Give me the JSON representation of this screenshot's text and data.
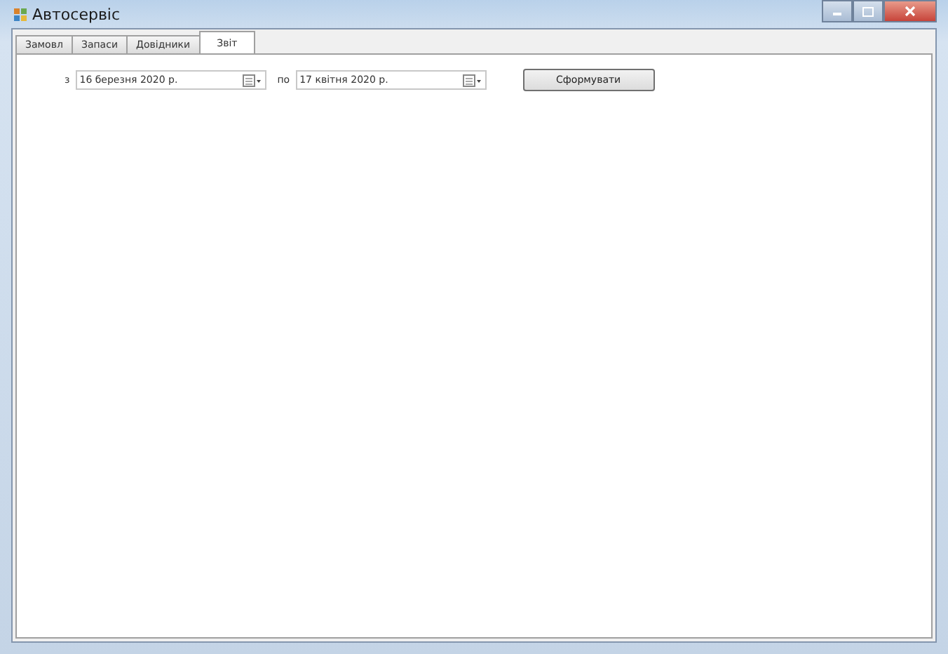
{
  "window": {
    "title": "Автосервіс"
  },
  "tabs": [
    {
      "label": "Замовл",
      "selected": false
    },
    {
      "label": "Запаси",
      "selected": false
    },
    {
      "label": "Довідники",
      "selected": false
    },
    {
      "label": "Звіт",
      "selected": true
    }
  ],
  "report": {
    "from_label": "з",
    "from_date": "16 березня 2020 р.",
    "to_label": "по",
    "to_date": "17 квітня 2020 р.",
    "button": "Сформувати"
  }
}
